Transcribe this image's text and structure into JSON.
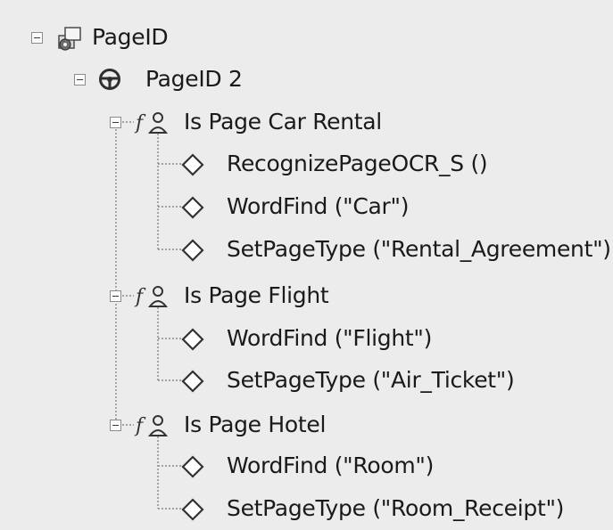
{
  "tree": {
    "root": {
      "label": "PageID",
      "icon": "document-stack-icon"
    },
    "child": {
      "label": "PageID 2",
      "icon": "steering-wheel-icon"
    },
    "rules": [
      {
        "label": "Is Page Car Rental",
        "icon": "function-rule-icon",
        "actions": [
          "RecognizePageOCR_S ()",
          "WordFind (\"Car\")",
          "SetPageType (\"Rental_Agreement\")"
        ]
      },
      {
        "label": "Is Page Flight",
        "icon": "function-rule-icon",
        "actions": [
          "WordFind (\"Flight\")",
          "SetPageType (\"Air_Ticket\")"
        ]
      },
      {
        "label": "Is Page Hotel",
        "icon": "function-rule-icon",
        "actions": [
          "WordFind (\"Room\")",
          "SetPageType (\"Room_Receipt\")"
        ]
      }
    ]
  }
}
